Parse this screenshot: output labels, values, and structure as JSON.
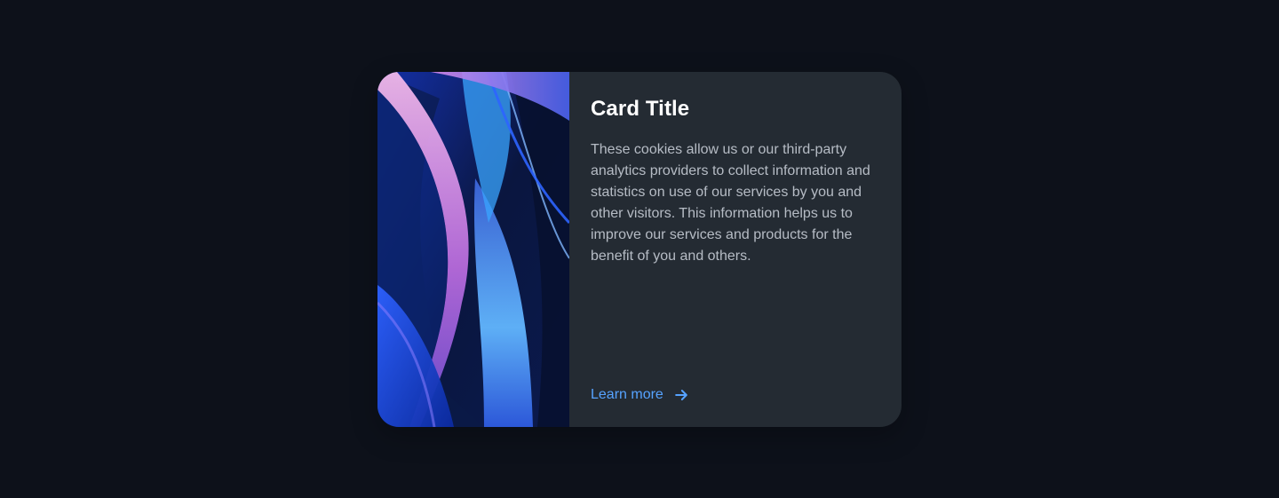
{
  "page": {
    "background": "#0d111a"
  },
  "card": {
    "title": "Card Title",
    "description": "These cookies allow us or our third-party analytics providers to collect information and statistics on use of our services by you and other visitors. This information helps us to improve our services and products for the benefit of you and others.",
    "link_label": "Learn more",
    "link_icon": "arrow-right-icon",
    "colors": {
      "card_bg": "#242b33",
      "title": "#ffffff",
      "text": "#b6bcc5",
      "link": "#56a3ff"
    },
    "image": {
      "icon": "abstract-ribbon-image"
    }
  }
}
